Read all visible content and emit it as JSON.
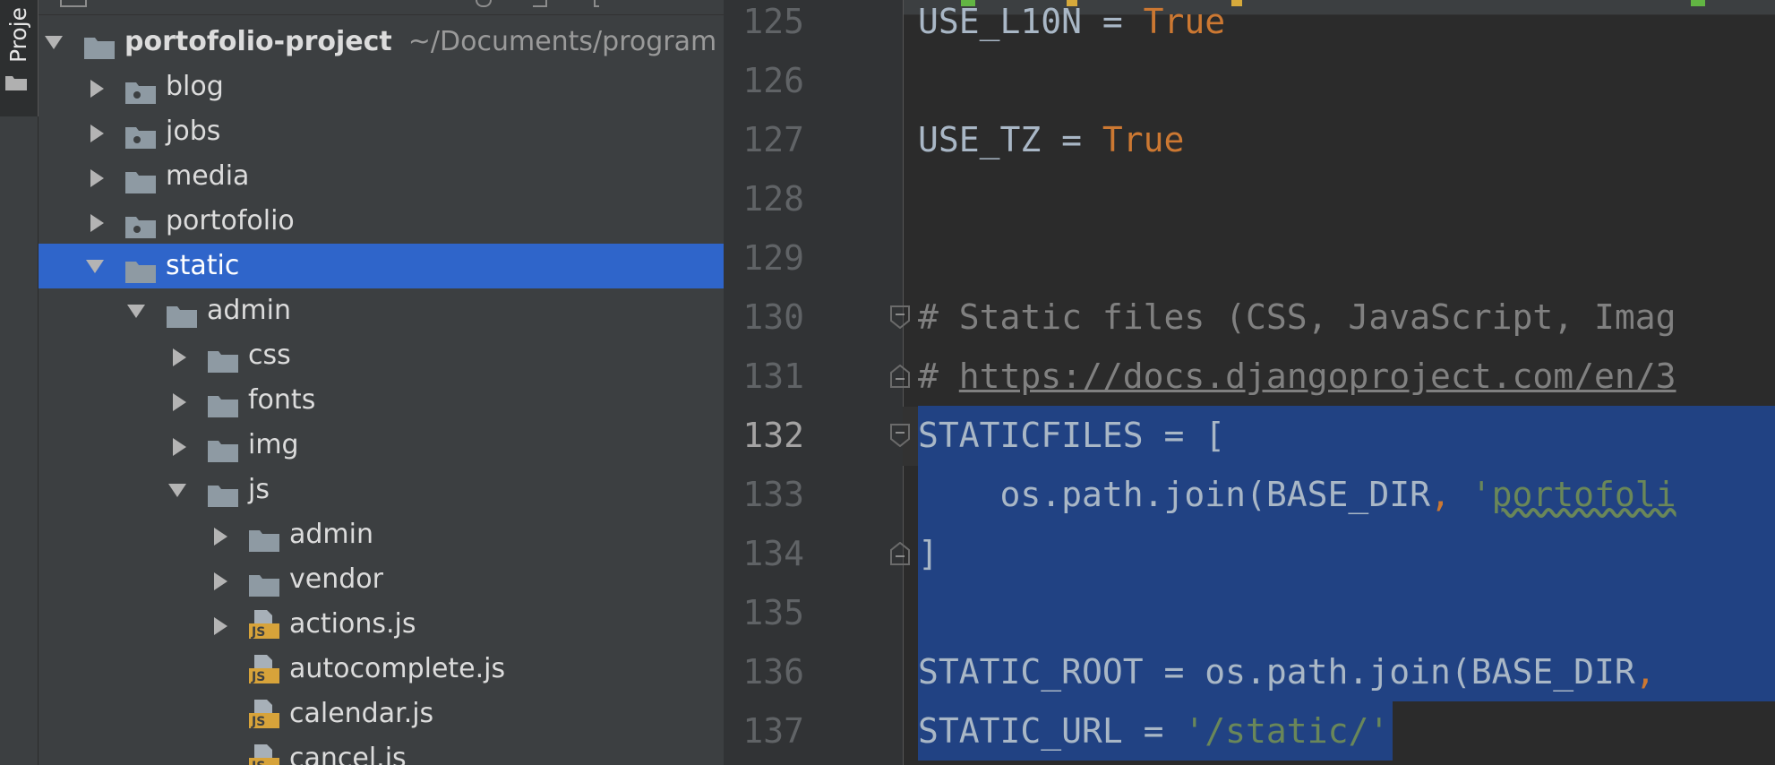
{
  "tool_window": {
    "tab_label": "Proje"
  },
  "project_tree": [
    {
      "label": "portofolio-project",
      "path": "~/Documents/program",
      "depth": 0,
      "expanded": true,
      "type": "project-folder"
    },
    {
      "label": "blog",
      "depth": 1,
      "expanded": false,
      "type": "module-folder"
    },
    {
      "label": "jobs",
      "depth": 1,
      "expanded": false,
      "type": "module-folder"
    },
    {
      "label": "media",
      "depth": 1,
      "expanded": false,
      "type": "folder"
    },
    {
      "label": "portofolio",
      "depth": 1,
      "expanded": false,
      "type": "module-folder"
    },
    {
      "label": "static",
      "depth": 1,
      "expanded": true,
      "type": "folder",
      "selected": true
    },
    {
      "label": "admin",
      "depth": 2,
      "expanded": true,
      "type": "folder"
    },
    {
      "label": "css",
      "depth": 3,
      "expanded": false,
      "type": "folder"
    },
    {
      "label": "fonts",
      "depth": 3,
      "expanded": false,
      "type": "folder"
    },
    {
      "label": "img",
      "depth": 3,
      "expanded": false,
      "type": "folder"
    },
    {
      "label": "js",
      "depth": 3,
      "expanded": true,
      "type": "folder"
    },
    {
      "label": "admin",
      "depth": 4,
      "expanded": false,
      "type": "folder"
    },
    {
      "label": "vendor",
      "depth": 4,
      "expanded": false,
      "type": "folder"
    },
    {
      "label": "actions.js",
      "depth": 4,
      "expanded": false,
      "type": "js-file"
    },
    {
      "label": "autocomplete.js",
      "depth": 4,
      "type": "js-file"
    },
    {
      "label": "calendar.js",
      "depth": 4,
      "type": "js-file"
    },
    {
      "label": "cancel.js",
      "depth": 4,
      "type": "js-file"
    }
  ],
  "editor": {
    "current_line": "132",
    "lines": [
      {
        "num": "125",
        "segments": [
          {
            "t": "USE_L10N = ",
            "c": "plain"
          },
          {
            "t": "True",
            "c": "kw"
          }
        ]
      },
      {
        "num": "126",
        "segments": []
      },
      {
        "num": "127",
        "segments": [
          {
            "t": "USE_TZ = ",
            "c": "plain"
          },
          {
            "t": "True",
            "c": "kw"
          }
        ]
      },
      {
        "num": "128",
        "segments": []
      },
      {
        "num": "129",
        "segments": []
      },
      {
        "num": "130",
        "segments": [
          {
            "t": "# Static files (CSS, JavaScript, Imag",
            "c": "cmt"
          }
        ]
      },
      {
        "num": "131",
        "segments": [
          {
            "t": "# ",
            "c": "cmt"
          },
          {
            "t": "https://docs.djangoproject.com/en/3",
            "c": "link"
          }
        ]
      },
      {
        "num": "132",
        "segments": [
          {
            "t": "STATICFILES = [",
            "c": "plain"
          }
        ]
      },
      {
        "num": "133",
        "segments": [
          {
            "t": "    os.path.join(BASE_DIR",
            "c": "plain"
          },
          {
            "t": ", ",
            "c": "kw"
          },
          {
            "t": "'",
            "c": "str"
          },
          {
            "t": "portofoli",
            "c": "str typo"
          }
        ]
      },
      {
        "num": "134",
        "segments": [
          {
            "t": "]",
            "c": "plain"
          }
        ]
      },
      {
        "num": "135",
        "segments": []
      },
      {
        "num": "136",
        "segments": [
          {
            "t": "STATIC_ROOT = os.path.join(BASE_DIR",
            "c": "plain"
          },
          {
            "t": ",",
            "c": "kw"
          }
        ]
      },
      {
        "num": "137",
        "segments": [
          {
            "t": "STATIC_URL = ",
            "c": "plain"
          },
          {
            "t": "'/static/'",
            "c": "str"
          }
        ]
      }
    ]
  },
  "colors": {
    "selection": "#2f65ca",
    "editor_selection": "#214283",
    "keyword": "#cc7832",
    "string": "#6a8759",
    "comment": "#808080"
  }
}
